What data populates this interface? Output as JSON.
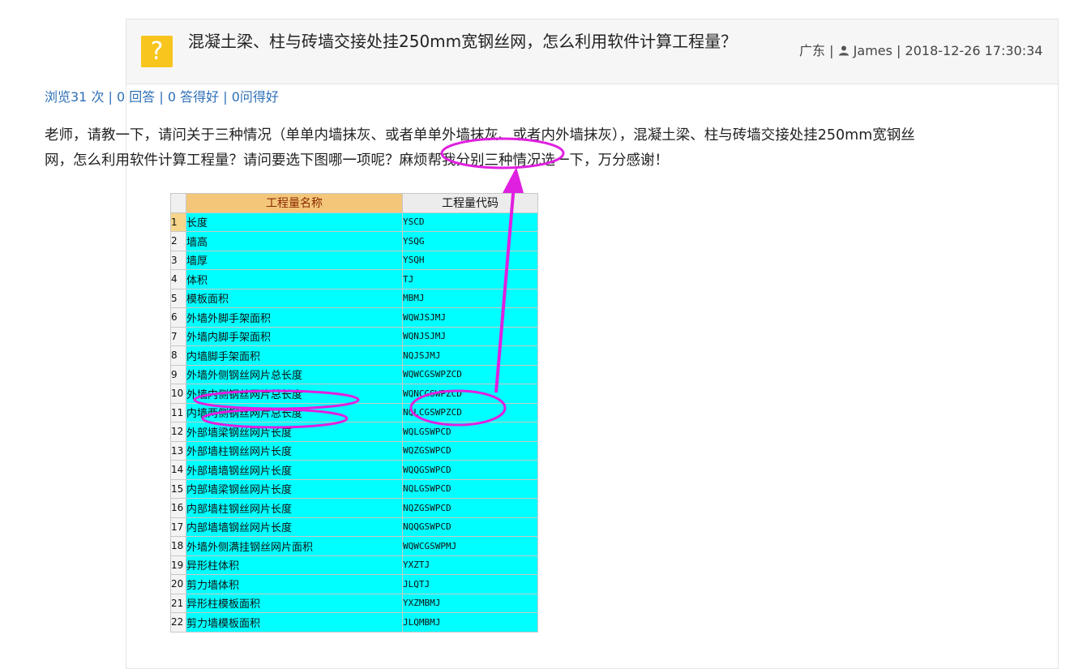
{
  "question": {
    "title": "混凝土梁、柱与砖墙交接处挂250mm宽钢丝网，怎么利用软件计算工程量？",
    "icon": "question-icon",
    "meta": {
      "region": "广东",
      "separator": " | ",
      "user": "James",
      "datetime": "2018-12-26 17:30:34"
    },
    "stats": {
      "views": "浏览31 次",
      "answers": "0 回答",
      "good_answers": "0 答得好",
      "good_questions": "0问得好",
      "sep": " | "
    },
    "body": "老师，请教一下，请问关于三种情况（单单内墙抹灰、或者单单外墙抹灰、或者内外墙抹灰），混凝土梁、柱与砖墙交接处挂250mm宽钢丝网，怎么利用软件计算工程量？请问要选下图哪一项呢？麻烦帮我分别三种情况选一下，万分感谢！"
  },
  "table": {
    "headers": [
      "工程量名称",
      "工程量代码"
    ],
    "rows": [
      {
        "n": "1",
        "name": "长度",
        "code": "YSCD"
      },
      {
        "n": "2",
        "name": "墙高",
        "code": "YSQG"
      },
      {
        "n": "3",
        "name": "墙厚",
        "code": "YSQH"
      },
      {
        "n": "4",
        "name": "体积",
        "code": "TJ"
      },
      {
        "n": "5",
        "name": "模板面积",
        "code": "MBMJ"
      },
      {
        "n": "6",
        "name": "外墙外脚手架面积",
        "code": "WQWJSJMJ"
      },
      {
        "n": "7",
        "name": "外墙内脚手架面积",
        "code": "WQNJSJMJ"
      },
      {
        "n": "8",
        "name": "内墙脚手架面积",
        "code": "NQJSJMJ"
      },
      {
        "n": "9",
        "name": "外墙外侧钢丝网片总长度",
        "code": "WQWCGSWPZCD"
      },
      {
        "n": "10",
        "name": "外墙内侧钢丝网片总长度",
        "code": "WQNCGSWPZCD"
      },
      {
        "n": "11",
        "name": "内墙两侧钢丝网片总长度",
        "code": "NQLCGSWPZCD"
      },
      {
        "n": "12",
        "name": "外部墙梁钢丝网片长度",
        "code": "WQLGSWPCD"
      },
      {
        "n": "13",
        "name": "外部墙柱钢丝网片长度",
        "code": "WQZGSWPCD"
      },
      {
        "n": "14",
        "name": "外部墙墙钢丝网片长度",
        "code": "WQQGSWPCD"
      },
      {
        "n": "15",
        "name": "内部墙梁钢丝网片长度",
        "code": "NQLGSWPCD"
      },
      {
        "n": "16",
        "name": "内部墙柱钢丝网片长度",
        "code": "NQZGSWPCD"
      },
      {
        "n": "17",
        "name": "内部墙墙钢丝网片长度",
        "code": "NQQGSWPCD"
      },
      {
        "n": "18",
        "name": "外墙外侧满挂钢丝网片面积",
        "code": "WQWCGSWPMJ"
      },
      {
        "n": "19",
        "name": "异形柱体积",
        "code": "YXZTJ"
      },
      {
        "n": "20",
        "name": "剪力墙体积",
        "code": "JLQTJ"
      },
      {
        "n": "21",
        "name": "异形柱模板面积",
        "code": "YXZMBMJ"
      },
      {
        "n": "22",
        "name": "剪力墙模板面积",
        "code": "JLQMBMJ"
      }
    ]
  },
  "annotation_color": "#e020e0",
  "colors": {
    "cell": "#00ffff",
    "header": "#f3c67a",
    "link": "#2d6fb6",
    "icon": "#f7c51d"
  }
}
